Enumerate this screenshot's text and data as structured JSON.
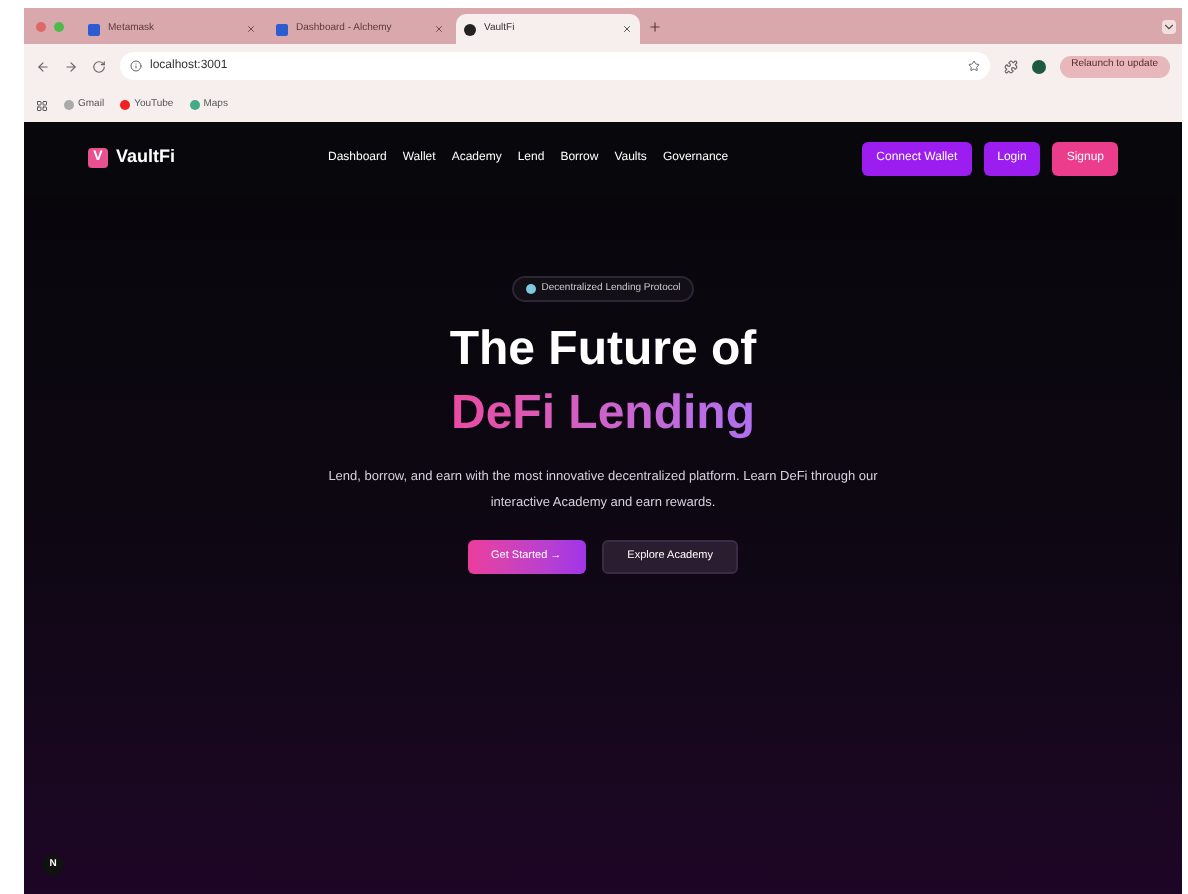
{
  "browser": {
    "tabs": [
      {
        "title": "Metamask",
        "selected": false
      },
      {
        "title": "Dashboard - Alchemy",
        "selected": false
      },
      {
        "title": "VaultFi",
        "selected": true
      }
    ],
    "url": "localhost:3001",
    "relaunch": "Relaunch to update",
    "bookmarks": [
      "Gmail",
      "YouTube",
      "Maps"
    ]
  },
  "nav": {
    "brand": "VaultFi",
    "logo_letter": "V",
    "links": [
      "Dashboard",
      "Wallet",
      "Academy",
      "Lend",
      "Borrow",
      "Vaults",
      "Governance"
    ],
    "buttons": [
      {
        "kind": "connect",
        "label": "Connect Wallet"
      },
      {
        "kind": "login",
        "label": "Login"
      },
      {
        "kind": "signup",
        "label": "Signup"
      }
    ]
  },
  "hero": {
    "badge": "Decentralized Lending Protocol",
    "title_line_1": "The Future of",
    "title_line_2": "DeFi Lending",
    "subtitle": "Lend, borrow, and earn with the most innovative decentralized platform. Learn DeFi through our interactive Academy and earn rewards.",
    "buttons": [
      {
        "kind": "primary",
        "label": "Get Started →"
      },
      {
        "kind": "secondary",
        "label": "Explore Academy"
      }
    ]
  },
  "dev_indicator": "N"
}
